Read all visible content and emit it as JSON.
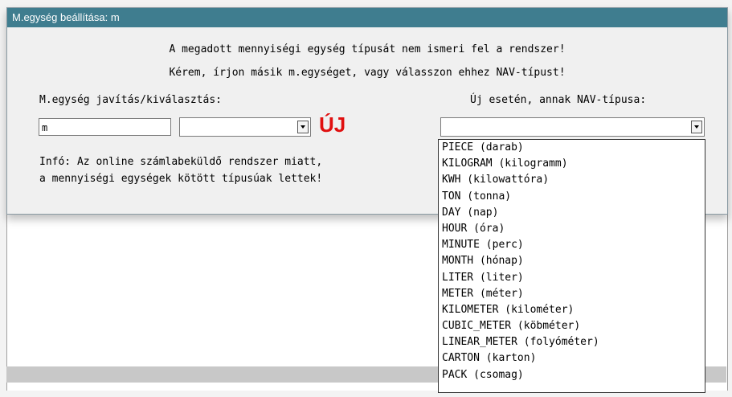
{
  "window": {
    "title": "M.egység beállítása: m"
  },
  "message": {
    "line1": "A megadott mennyiségi egység típusát nem ismeri fel a rendszer!",
    "line2": "Kérem, írjon másik m.egységet, vagy válasszon ehhez NAV-típust!"
  },
  "left": {
    "label": "M.egység javítás/kiválasztás:",
    "unit_value": "m",
    "unit_select_value": "",
    "new_badge": "ÚJ"
  },
  "right": {
    "label": "Új esetén, annak NAV-típusa:",
    "nav_type_value": ""
  },
  "info": {
    "line1": "Infó: Az online számlabeküldő rendszer miatt,",
    "line2": "a mennyiségi egységek kötött típusúak lettek!"
  },
  "nav_options": [
    "PIECE (darab)",
    "KILOGRAM (kilogramm)",
    "KWH (kilowattóra)",
    "TON (tonna)",
    "DAY (nap)",
    "HOUR (óra)",
    "MINUTE (perc)",
    "MONTH (hónap)",
    "LITER (liter)",
    "METER (méter)",
    "KILOMETER (kilométer)",
    "CUBIC_METER (köbméter)",
    "LINEAR_METER (folyóméter)",
    "CARTON (karton)",
    "PACK (csomag)"
  ],
  "colors": {
    "titlebar": "#3f7d8f",
    "new_badge": "#e01010"
  }
}
